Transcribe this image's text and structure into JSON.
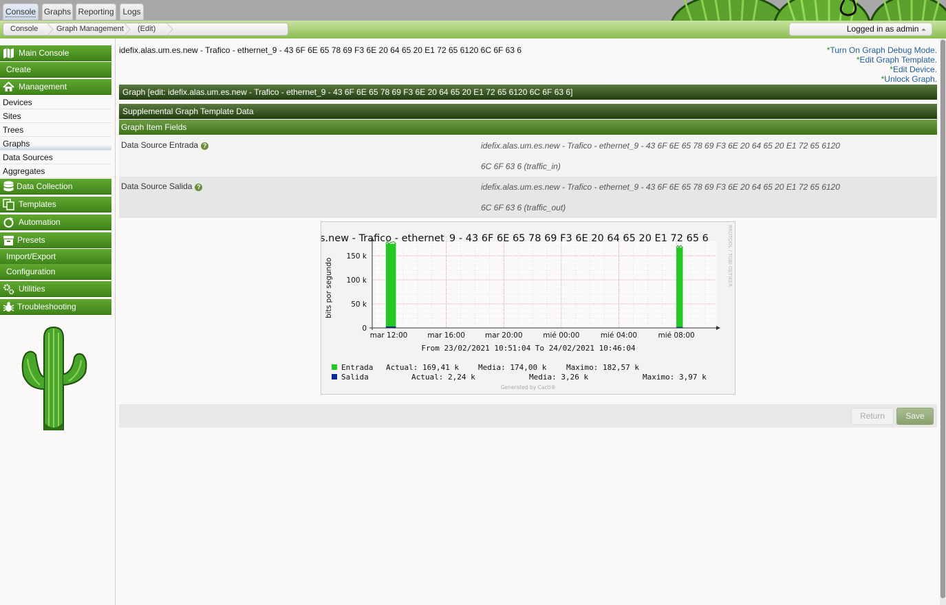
{
  "top_tabs": [
    {
      "label": "Console",
      "active": true
    },
    {
      "label": "Graphs",
      "active": false
    },
    {
      "label": "Reporting",
      "active": false
    },
    {
      "label": "Logs",
      "active": false
    }
  ],
  "breadcrumbs": [
    "Console",
    "Graph Management",
    "(Edit)"
  ],
  "login_text": "Logged in as admin",
  "login_caret": "⏶",
  "sidebar": {
    "main_console": "Main Console",
    "create": "Create",
    "management": "Management",
    "management_items": [
      "Devices",
      "Sites",
      "Trees",
      "Graphs",
      "Data Sources",
      "Aggregates"
    ],
    "selected_item": "Graphs",
    "data_collection": "Data Collection",
    "templates": "Templates",
    "automation": "Automation",
    "presets": "Presets",
    "import_export": "Import/Export",
    "configuration": "Configuration",
    "utilities": "Utilities",
    "troubleshooting": "Troubleshooting"
  },
  "main": {
    "graph_title": "idefix.alas.um.es.new - Trafico - ethernet_9 - 43 6F 6E 65 78 69 F3 6E 20 64 65 20 E1 72 65 6120 6C 6F 63 6",
    "links": {
      "star": "*",
      "debug": "Turn On Graph Debug Mode.",
      "edit_template": "Edit Graph Template.",
      "edit_device": "Edit Device.",
      "unlock": "Unlock Graph."
    },
    "graph_edit_header": "Graph [edit: idefix.alas.um.es.new - Trafico - ethernet_9 - 43 6F 6E 65 78 69 F3 6E 20 64 65 20 E1 72 65 6120 6C 6F 63 6]",
    "supplemental_header": "Supplemental Graph Template Data",
    "item_fields_header": "Graph Item Fields",
    "help_glyph": "?",
    "fields": [
      {
        "label": "Data Source Entrada",
        "line1": "idefix.alas.um.es.new - Trafico - ethernet_9 - 43 6F 6E 65 78 69 F3 6E 20 64 65 20 E1 72 65 6120",
        "line2": "6C 6F 63 6 (traffic_in)"
      },
      {
        "label": "Data Source Salida",
        "line1": "idefix.alas.um.es.new - Trafico - ethernet_9 - 43 6F 6E 65 78 69 F3 6E 20 64 65 20 E1 72 65 6120",
        "line2": "6C 6F 63 6 (traffic_out)"
      }
    ],
    "return_label": "Return",
    "save_label": "Save"
  },
  "chart_data": {
    "type": "area",
    "title": "s.new - Trafico - ethernet_9 - 43 6F 6E 65 78 69 F3 6E 20 64 65 20 E1 72 65 6",
    "ylabel": "bits por segundo",
    "ylim": [
      0,
      180000
    ],
    "yticks": [
      {
        "value": 0,
        "label": "0"
      },
      {
        "value": 50000,
        "label": "50 k"
      },
      {
        "value": 100000,
        "label": "100 k"
      },
      {
        "value": 150000,
        "label": "150 k"
      }
    ],
    "xticks": [
      {
        "hour": 12,
        "label": "mar 12:00"
      },
      {
        "hour": 16,
        "label": "mar 16:00"
      },
      {
        "hour": 20,
        "label": "mar 20:00"
      },
      {
        "hour": 24,
        "label": "mié 00:00"
      },
      {
        "hour": 28,
        "label": "mié 04:00"
      },
      {
        "hour": 32,
        "label": "mié 08:00"
      }
    ],
    "time_range": "From 23/02/2021 10:51:04 To 24/02/2021 10:46:04",
    "watermark": "RRDTOOL / TOBI OETIKER",
    "footer": "Generated by Cacti®",
    "series": [
      {
        "name": "Entrada",
        "color": "#24c824",
        "bursts": [
          {
            "start": 11.8,
            "end": 12.5,
            "value": 175000
          },
          {
            "start": 32.0,
            "end": 32.45,
            "value": 167000
          }
        ],
        "legend": {
          "actual": "Actual:  169,41 k",
          "media": "Media:  174,00 k",
          "maximo": "Maximo:  182,57 k"
        }
      },
      {
        "name": "Salida",
        "color": "#0c2a8a",
        "bursts": [
          {
            "start": 11.8,
            "end": 12.5,
            "value": 3000
          },
          {
            "start": 32.0,
            "end": 32.45,
            "value": 2000
          }
        ],
        "legend": {
          "actual": "Actual:    2,24 k",
          "media": "Media:    3,26 k",
          "maximo": "Maximo:    3,97 k"
        }
      }
    ]
  }
}
